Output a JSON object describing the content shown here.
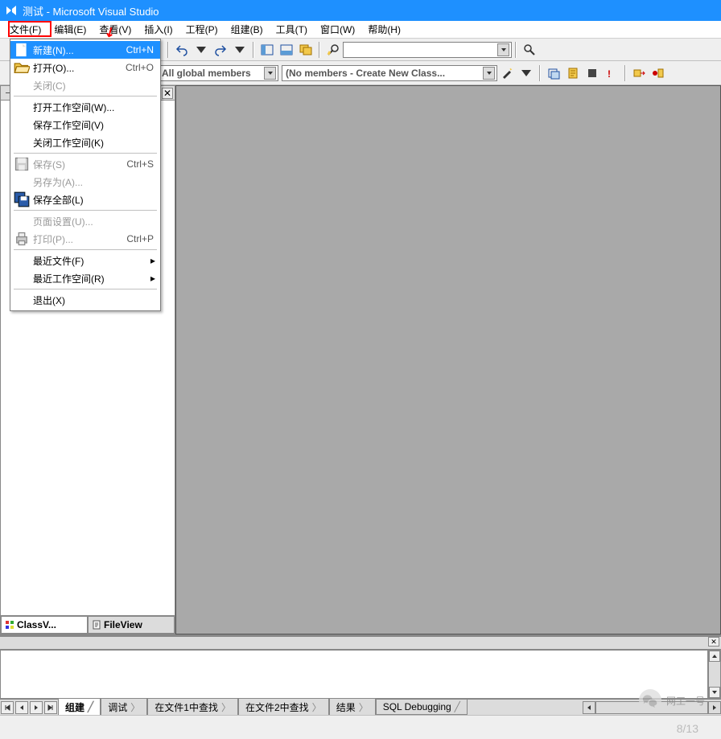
{
  "title": "测试 - Microsoft Visual Studio",
  "menubar": [
    "文件(F)",
    "编辑(E)",
    "查看(V)",
    "插入(I)",
    "工程(P)",
    "组建(B)",
    "工具(T)",
    "窗口(W)",
    "帮助(H)"
  ],
  "file_menu": [
    {
      "icon": "new",
      "label": "新建(N)...",
      "shortcut": "Ctrl+N",
      "hi": true
    },
    {
      "icon": "open",
      "label": "打开(O)...",
      "shortcut": "Ctrl+O"
    },
    {
      "label": "关闭(C)",
      "dis": true
    },
    {
      "sep": true
    },
    {
      "label": "打开工作空间(W)..."
    },
    {
      "label": "保存工作空间(V)"
    },
    {
      "label": "关闭工作空间(K)"
    },
    {
      "sep": true
    },
    {
      "icon": "save",
      "label": "保存(S)",
      "shortcut": "Ctrl+S",
      "dis": true
    },
    {
      "label": "另存为(A)...",
      "dis": true
    },
    {
      "icon": "saveall",
      "label": "保存全部(L)"
    },
    {
      "sep": true
    },
    {
      "label": "页面设置(U)...",
      "dis": true
    },
    {
      "icon": "print",
      "label": "打印(P)...",
      "shortcut": "Ctrl+P",
      "dis": true
    },
    {
      "sep": true
    },
    {
      "label": "最近文件(F)",
      "sub": true
    },
    {
      "label": "最近工作空间(R)",
      "sub": true
    },
    {
      "sep": true
    },
    {
      "label": "退出(X)"
    }
  ],
  "combo_members": "All global members",
  "combo_noclass": "(No members - Create New Class...",
  "pane_tabs": {
    "class": "ClassV...",
    "file": "FileView"
  },
  "bottom_tabs": [
    "组建",
    "调试",
    "在文件1中查找",
    "在文件2中查找",
    "结果",
    "SQL Debugging"
  ],
  "watermark": "网工一号",
  "pagecount": "8/13"
}
